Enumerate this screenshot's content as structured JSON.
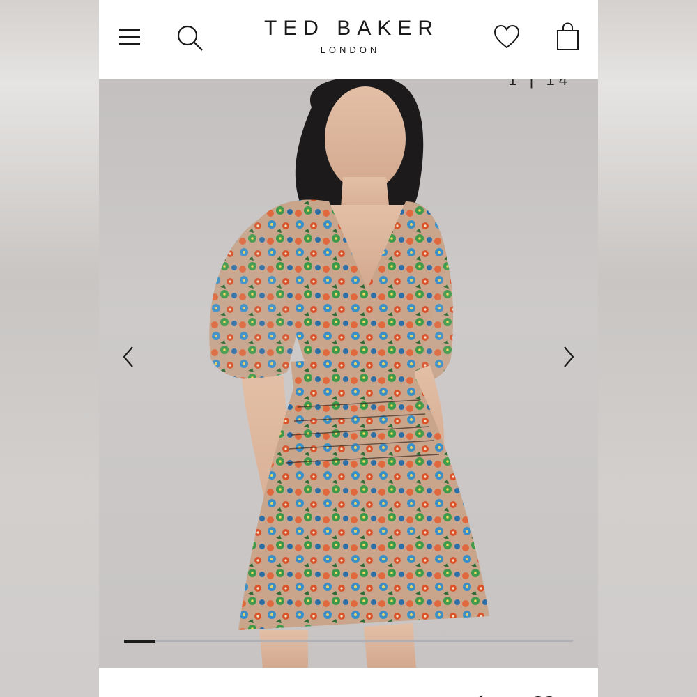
{
  "header": {
    "brand_name": "TED BAKER",
    "brand_sub": "LONDON",
    "menu_icon": "hamburger-menu-icon",
    "search_icon": "search-icon",
    "wishlist_icon": "heart-icon",
    "bag_icon": "shopping-bag-icon"
  },
  "gallery": {
    "current_image": "1",
    "separator": "|",
    "total_images": "14",
    "progress_fraction": 0.07,
    "prev_icon": "chevron-left-icon",
    "next_icon": "chevron-right-icon",
    "image_subject": "model-wearing-floral-mini-dress"
  },
  "colors": {
    "text_dark": "#1a1a1a",
    "progress_active": "#1b1b1b",
    "progress_track": "#aeb0b6"
  }
}
